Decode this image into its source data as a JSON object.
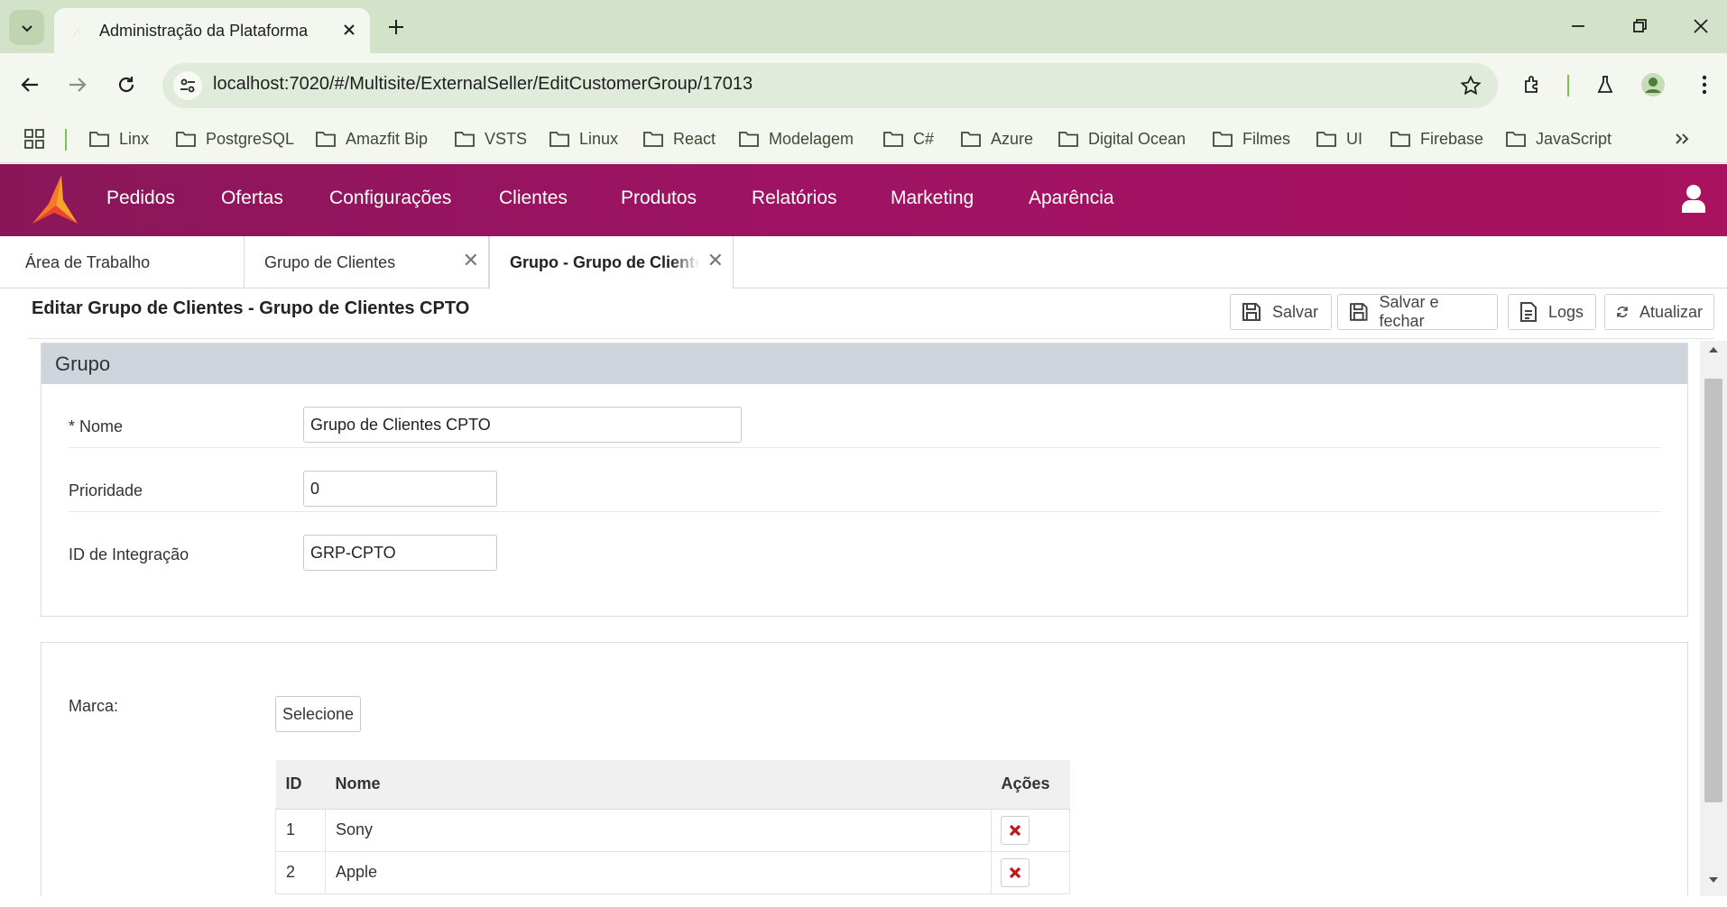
{
  "browser": {
    "tab_title": "Administração da Plataforma",
    "url": "localhost:7020/#/Multisite/ExternalSeller/EditCustomerGroup/17013",
    "bookmarks": [
      "Linx",
      "PostgreSQL",
      "Amazfit Bip",
      "VSTS",
      "Linux",
      "React",
      "Modelagem",
      "C#",
      "Azure",
      "Digital Ocean",
      "Filmes",
      "UI",
      "Firebase",
      "JavaScript"
    ]
  },
  "app": {
    "menu": [
      "Pedidos",
      "Ofertas",
      "Configurações",
      "Clientes",
      "Produtos",
      "Relatórios",
      "Marketing",
      "Aparência"
    ],
    "tabs": [
      "Área de Trabalho",
      "Grupo de Clientes",
      "Grupo - Grupo de Clientes"
    ],
    "accent": "#9e1364"
  },
  "page": {
    "title": "Editar Grupo de Clientes - Grupo de Clientes CPTO",
    "toolbar": {
      "save": "Salvar",
      "save_close": "Salvar e fechar",
      "logs": "Logs",
      "refresh": "Atualizar"
    }
  },
  "group_panel": {
    "heading": "Grupo",
    "fields": [
      {
        "label": "* Nome",
        "value": "Grupo de Clientes CPTO"
      },
      {
        "label": "Prioridade",
        "value": "0"
      },
      {
        "label": "ID de Integração",
        "value": "GRP-CPTO"
      }
    ]
  },
  "brand_panel": {
    "label": "Marca:",
    "select_button": "Selecione",
    "table": {
      "columns": [
        "ID",
        "Nome",
        "Ações"
      ],
      "rows": [
        {
          "id": "1",
          "name": "Sony"
        },
        {
          "id": "2",
          "name": "Apple"
        }
      ]
    }
  }
}
